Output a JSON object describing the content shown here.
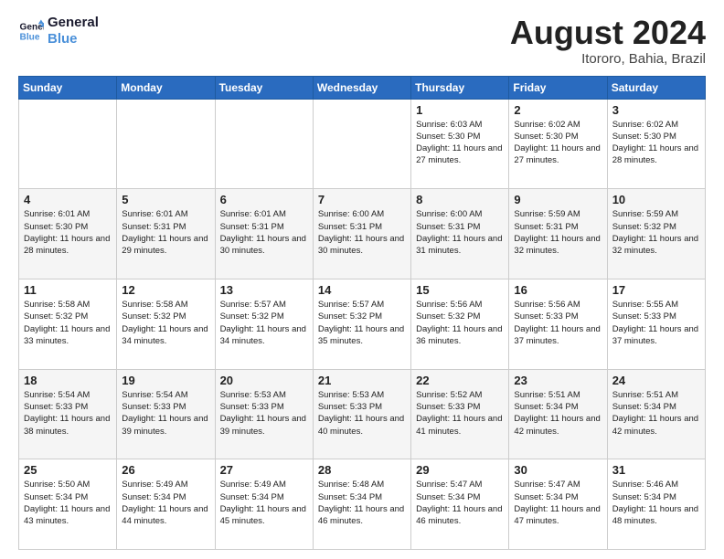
{
  "logo": {
    "line1": "General",
    "line2": "Blue"
  },
  "title": "August 2024",
  "subtitle": "Itororo, Bahia, Brazil",
  "days_of_week": [
    "Sunday",
    "Monday",
    "Tuesday",
    "Wednesday",
    "Thursday",
    "Friday",
    "Saturday"
  ],
  "weeks": [
    [
      {
        "day": "",
        "info": ""
      },
      {
        "day": "",
        "info": ""
      },
      {
        "day": "",
        "info": ""
      },
      {
        "day": "",
        "info": ""
      },
      {
        "day": "1",
        "info": "Sunrise: 6:03 AM\nSunset: 5:30 PM\nDaylight: 11 hours and 27 minutes."
      },
      {
        "day": "2",
        "info": "Sunrise: 6:02 AM\nSunset: 5:30 PM\nDaylight: 11 hours and 27 minutes."
      },
      {
        "day": "3",
        "info": "Sunrise: 6:02 AM\nSunset: 5:30 PM\nDaylight: 11 hours and 28 minutes."
      }
    ],
    [
      {
        "day": "4",
        "info": "Sunrise: 6:01 AM\nSunset: 5:30 PM\nDaylight: 11 hours and 28 minutes."
      },
      {
        "day": "5",
        "info": "Sunrise: 6:01 AM\nSunset: 5:31 PM\nDaylight: 11 hours and 29 minutes."
      },
      {
        "day": "6",
        "info": "Sunrise: 6:01 AM\nSunset: 5:31 PM\nDaylight: 11 hours and 30 minutes."
      },
      {
        "day": "7",
        "info": "Sunrise: 6:00 AM\nSunset: 5:31 PM\nDaylight: 11 hours and 30 minutes."
      },
      {
        "day": "8",
        "info": "Sunrise: 6:00 AM\nSunset: 5:31 PM\nDaylight: 11 hours and 31 minutes."
      },
      {
        "day": "9",
        "info": "Sunrise: 5:59 AM\nSunset: 5:31 PM\nDaylight: 11 hours and 32 minutes."
      },
      {
        "day": "10",
        "info": "Sunrise: 5:59 AM\nSunset: 5:32 PM\nDaylight: 11 hours and 32 minutes."
      }
    ],
    [
      {
        "day": "11",
        "info": "Sunrise: 5:58 AM\nSunset: 5:32 PM\nDaylight: 11 hours and 33 minutes."
      },
      {
        "day": "12",
        "info": "Sunrise: 5:58 AM\nSunset: 5:32 PM\nDaylight: 11 hours and 34 minutes."
      },
      {
        "day": "13",
        "info": "Sunrise: 5:57 AM\nSunset: 5:32 PM\nDaylight: 11 hours and 34 minutes."
      },
      {
        "day": "14",
        "info": "Sunrise: 5:57 AM\nSunset: 5:32 PM\nDaylight: 11 hours and 35 minutes."
      },
      {
        "day": "15",
        "info": "Sunrise: 5:56 AM\nSunset: 5:32 PM\nDaylight: 11 hours and 36 minutes."
      },
      {
        "day": "16",
        "info": "Sunrise: 5:56 AM\nSunset: 5:33 PM\nDaylight: 11 hours and 37 minutes."
      },
      {
        "day": "17",
        "info": "Sunrise: 5:55 AM\nSunset: 5:33 PM\nDaylight: 11 hours and 37 minutes."
      }
    ],
    [
      {
        "day": "18",
        "info": "Sunrise: 5:54 AM\nSunset: 5:33 PM\nDaylight: 11 hours and 38 minutes."
      },
      {
        "day": "19",
        "info": "Sunrise: 5:54 AM\nSunset: 5:33 PM\nDaylight: 11 hours and 39 minutes."
      },
      {
        "day": "20",
        "info": "Sunrise: 5:53 AM\nSunset: 5:33 PM\nDaylight: 11 hours and 39 minutes."
      },
      {
        "day": "21",
        "info": "Sunrise: 5:53 AM\nSunset: 5:33 PM\nDaylight: 11 hours and 40 minutes."
      },
      {
        "day": "22",
        "info": "Sunrise: 5:52 AM\nSunset: 5:33 PM\nDaylight: 11 hours and 41 minutes."
      },
      {
        "day": "23",
        "info": "Sunrise: 5:51 AM\nSunset: 5:34 PM\nDaylight: 11 hours and 42 minutes."
      },
      {
        "day": "24",
        "info": "Sunrise: 5:51 AM\nSunset: 5:34 PM\nDaylight: 11 hours and 42 minutes."
      }
    ],
    [
      {
        "day": "25",
        "info": "Sunrise: 5:50 AM\nSunset: 5:34 PM\nDaylight: 11 hours and 43 minutes."
      },
      {
        "day": "26",
        "info": "Sunrise: 5:49 AM\nSunset: 5:34 PM\nDaylight: 11 hours and 44 minutes."
      },
      {
        "day": "27",
        "info": "Sunrise: 5:49 AM\nSunset: 5:34 PM\nDaylight: 11 hours and 45 minutes."
      },
      {
        "day": "28",
        "info": "Sunrise: 5:48 AM\nSunset: 5:34 PM\nDaylight: 11 hours and 46 minutes."
      },
      {
        "day": "29",
        "info": "Sunrise: 5:47 AM\nSunset: 5:34 PM\nDaylight: 11 hours and 46 minutes."
      },
      {
        "day": "30",
        "info": "Sunrise: 5:47 AM\nSunset: 5:34 PM\nDaylight: 11 hours and 47 minutes."
      },
      {
        "day": "31",
        "info": "Sunrise: 5:46 AM\nSunset: 5:34 PM\nDaylight: 11 hours and 48 minutes."
      }
    ]
  ]
}
